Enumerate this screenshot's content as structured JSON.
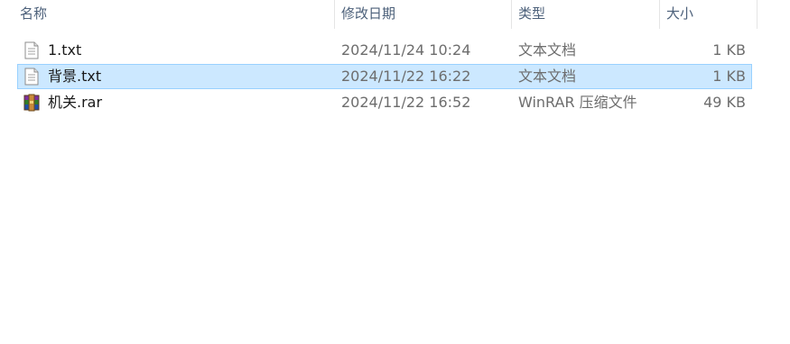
{
  "header": {
    "columns": {
      "name": "名称",
      "date": "修改日期",
      "type": "类型",
      "size": "大小"
    },
    "sort_indicator": "^"
  },
  "files": [
    {
      "name": "1.txt",
      "date": "2024/11/24 10:24",
      "type": "文本文档",
      "size": "1 KB",
      "icon": "text-file-icon",
      "selected": false
    },
    {
      "name": "背景.txt",
      "date": "2024/11/22 16:22",
      "type": "文本文档",
      "size": "1 KB",
      "icon": "text-file-icon",
      "selected": true
    },
    {
      "name": "机关.rar",
      "date": "2024/11/22 16:52",
      "type": "WinRAR 压缩文件",
      "size": "49 KB",
      "icon": "winrar-archive-icon",
      "selected": false
    }
  ],
  "colors": {
    "selection_fill": "#cce8ff",
    "selection_border": "#99d1ff",
    "header_text": "#4c607a",
    "secondary_text": "#6d6d6d"
  }
}
